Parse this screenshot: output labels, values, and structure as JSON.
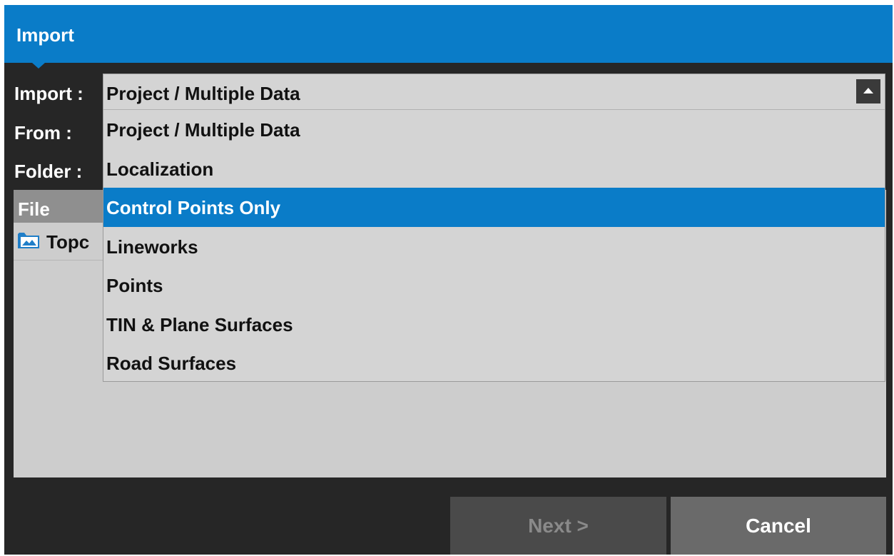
{
  "dialog": {
    "title": "Import"
  },
  "fields": {
    "import_label": "Import :",
    "from_label": "From :",
    "folder_label": "Folder :"
  },
  "import_dropdown": {
    "selected_value": "Project / Multiple Data",
    "toggle_icon": "caret-up-icon",
    "options": [
      {
        "label": "Project / Multiple Data",
        "selected": false
      },
      {
        "label": "Localization",
        "selected": false
      },
      {
        "label": "Control Points Only",
        "selected": true
      },
      {
        "label": "Lineworks",
        "selected": false
      },
      {
        "label": "Points",
        "selected": false
      },
      {
        "label": "TIN & Plane Surfaces",
        "selected": false
      },
      {
        "label": "Road Surfaces",
        "selected": false
      }
    ]
  },
  "file_list": {
    "header": "File",
    "rows": [
      {
        "icon": "image-folder-icon",
        "name": "Topc"
      }
    ]
  },
  "buttons": {
    "next_label": "Next >",
    "cancel_label": "Cancel"
  },
  "colors": {
    "accent": "#0a7cc8",
    "background": "#262626",
    "panel": "#cdcdcd"
  }
}
